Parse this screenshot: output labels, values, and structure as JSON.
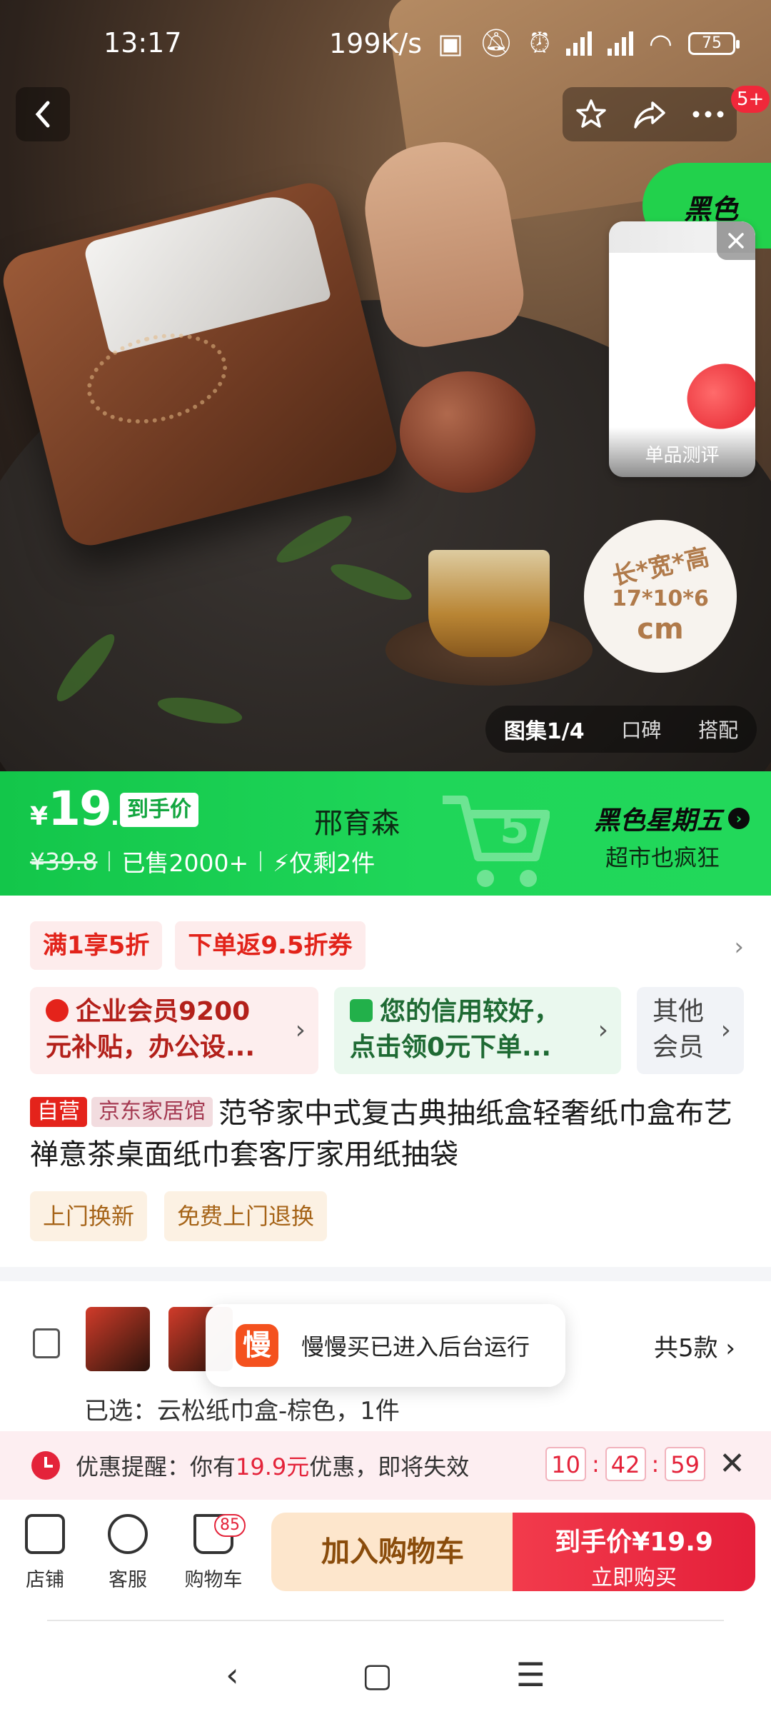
{
  "status_bar": {
    "time": "13:17",
    "net_speed": "199K/s",
    "battery": "75"
  },
  "hero": {
    "badge_count": "5+",
    "green_tab": "黑色",
    "video_label": "单品测评",
    "dimensions": {
      "line1": "长*宽*高",
      "line2": "17*10*6",
      "line3": "cm"
    },
    "gallery_tabs": [
      "图集1/4",
      "口碑",
      "搭配"
    ]
  },
  "price": {
    "currency": "¥",
    "integer": "19",
    "decimal": ".9",
    "tag": "到手价",
    "original": "¥39.8",
    "sold": "已售2000+",
    "stock": "仅剩2件",
    "seller": "邢育森",
    "promo_title": "黑色星期五",
    "promo_sub": "超市也疯狂"
  },
  "coupons": [
    "满1享5折",
    "下单返9.5折券"
  ],
  "member_cards": [
    {
      "text": "企业会员9200元补贴，办公设…",
      "line1": "企业会员9200",
      "line2": "元补贴，办公设..."
    },
    {
      "text": "您的信用较好，点击领0元下单…",
      "line1": "您的信用较好，",
      "line2": "点击领0元下单..."
    },
    {
      "text": "其他会员",
      "line1": "其他",
      "line2": "会员"
    }
  ],
  "product": {
    "tag_self": "自营",
    "tag_store": "京东家居馆",
    "title": "范爷家中式复古典抽纸盒轻奢纸巾盒布艺禅意茶桌面纸巾套客厅家用纸抽袋"
  },
  "services": [
    "上门换新",
    "免费上门退换"
  ],
  "variants": {
    "count": "共5款",
    "selected": "已选：云松纸巾盒-棕色，1件"
  },
  "toast": {
    "app_icon": "慢",
    "text": "慢慢买已进入后台运行"
  },
  "reminder": {
    "prefix": "优惠提醒：你有",
    "amount": "19.9元",
    "suffix": "优惠，即将失效",
    "hours": "10",
    "minutes": "42",
    "seconds": "59"
  },
  "action_bar": {
    "store": "店铺",
    "service": "客服",
    "cart": "购物车",
    "cart_count": "85",
    "add_to_cart": "加入购物车",
    "buy_price_label": "到手价¥19.9",
    "buy_now": "立即购买"
  },
  "colors": {
    "jd_red": "#e4231b",
    "promo_green": "#1fd659",
    "accent_orange": "#fde6cc"
  }
}
